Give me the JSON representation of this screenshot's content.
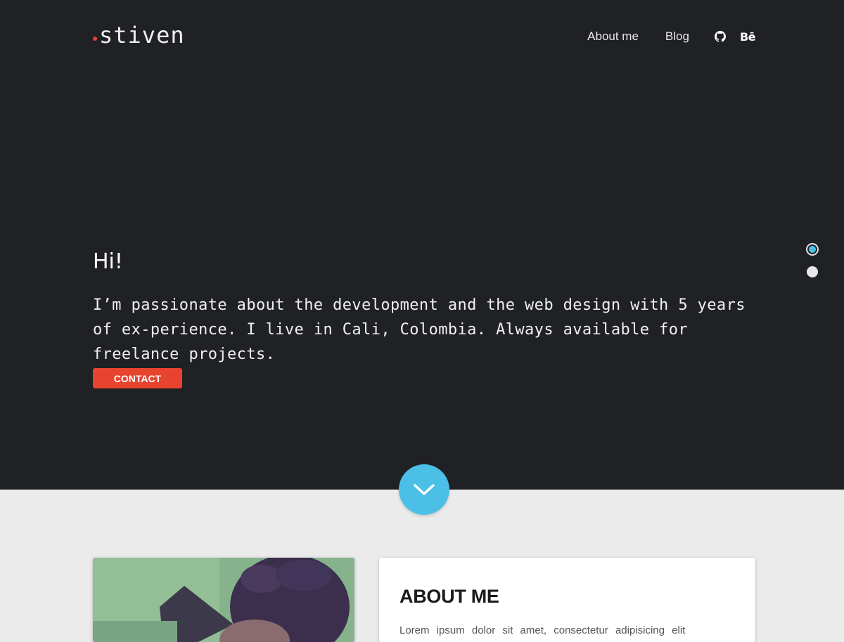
{
  "brand": {
    "name": "stiven",
    "dot_color": "#e8432f"
  },
  "nav": {
    "items": [
      {
        "label": "About me"
      },
      {
        "label": "Blog"
      }
    ],
    "social": [
      {
        "icon": "github-icon"
      },
      {
        "label": "Bē",
        "icon": "behance-icon"
      }
    ]
  },
  "hero": {
    "title": "Hi!",
    "body": "I’m passionate about the development and the web design with 5 years of ex-perience. I live in Cali, Colombia. Always available for freelance projects.",
    "cta_label": "CONTACT",
    "background": "#1f2124"
  },
  "slider": {
    "count": 2,
    "active_index": 0,
    "active_color": "#4bbfe6"
  },
  "scroll_down": {
    "icon": "chevron-down-icon",
    "color": "#4bbfe6"
  },
  "about": {
    "title": "ABOUT ME",
    "body": "Lorem ipsum dolor sit amet, consectetur adipisicing elit"
  },
  "colors": {
    "accent": "#e8432f",
    "secondary": "#4bbfe6",
    "page_bg": "#ebebeb"
  }
}
